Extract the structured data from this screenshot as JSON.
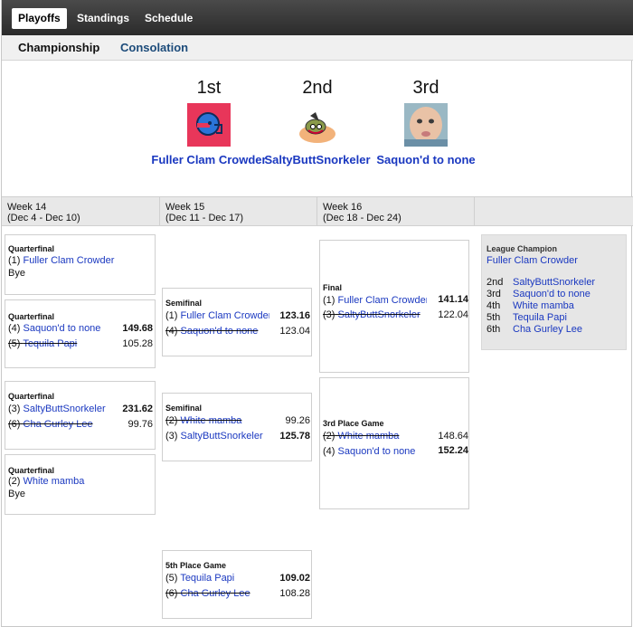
{
  "nav": {
    "tabs": [
      {
        "label": "Playoffs"
      },
      {
        "label": "Standings"
      },
      {
        "label": "Schedule"
      }
    ]
  },
  "subnav": {
    "tabs": [
      {
        "label": "Championship"
      },
      {
        "label": "Consolation"
      }
    ]
  },
  "podium": [
    {
      "place": "1st",
      "name": "Fuller Clam Crowder",
      "icon": "football-helmet-icon"
    },
    {
      "place": "2nd",
      "name": "SaltyButtSnorkeler",
      "icon": "bird-mascot-icon"
    },
    {
      "place": "3rd",
      "name": "Saquon'd to none",
      "icon": "baby-photo-icon"
    }
  ],
  "weeks": [
    {
      "title": "Week 14",
      "range": "(Dec 4 - Dec 10)"
    },
    {
      "title": "Week 15",
      "range": "(Dec 11 - Dec 17)"
    },
    {
      "title": "Week 16",
      "range": "(Dec 18 - Dec 24)"
    }
  ],
  "matches": {
    "qf1": {
      "title": "Quarterfinal",
      "a_seed": "(1)",
      "a_team": "Fuller Clam Crowder",
      "bye": "Bye"
    },
    "qf2": {
      "title": "Quarterfinal",
      "a_seed": "(4)",
      "a_team": "Saquon'd to none",
      "a_score": "149.68",
      "b_seed": "(5)",
      "b_team": "Tequila Papi",
      "b_score": "105.28"
    },
    "qf3": {
      "title": "Quarterfinal",
      "a_seed": "(3)",
      "a_team": "SaltyButtSnorkeler",
      "a_score": "231.62",
      "b_seed": "(6)",
      "b_team": "Cha Gurley Lee",
      "b_score": "99.76"
    },
    "qf4": {
      "title": "Quarterfinal",
      "a_seed": "(2)",
      "a_team": "White mamba",
      "bye": "Bye"
    },
    "sf1": {
      "title": "Semifinal",
      "a_seed": "(1)",
      "a_team": "Fuller Clam Crowder",
      "a_score": "123.16",
      "b_seed": "(4)",
      "b_team": "Saquon'd to none",
      "b_score": "123.04"
    },
    "sf2": {
      "title": "Semifinal",
      "a_seed": "(2)",
      "a_team": "White mamba",
      "a_score": "99.26",
      "b_seed": "(3)",
      "b_team": "SaltyButtSnorkeler",
      "b_score": "125.78"
    },
    "fifth": {
      "title": "5th Place Game",
      "a_seed": "(5)",
      "a_team": "Tequila Papi",
      "a_score": "109.02",
      "b_seed": "(6)",
      "b_team": "Cha Gurley Lee",
      "b_score": "108.28"
    },
    "final": {
      "title": "Final",
      "a_seed": "(1)",
      "a_team": "Fuller Clam Crowder",
      "a_score": "141.14",
      "b_seed": "(3)",
      "b_team": "SaltyButtSnorkeler",
      "b_score": "122.04"
    },
    "third": {
      "title": "3rd Place Game",
      "a_seed": "(2)",
      "a_team": "White mamba",
      "a_score": "148.64",
      "b_seed": "(4)",
      "b_team": "Saquon'd to none",
      "b_score": "152.24"
    }
  },
  "standings": {
    "title": "League Champion",
    "champion": "Fuller Clam Crowder",
    "rows": [
      {
        "place": "2nd",
        "team": "SaltyButtSnorkeler"
      },
      {
        "place": "3rd",
        "team": "Saquon'd to none"
      },
      {
        "place": "4th",
        "team": "White mamba"
      },
      {
        "place": "5th",
        "team": "Tequila Papi"
      },
      {
        "place": "6th",
        "team": "Cha Gurley Lee"
      }
    ]
  },
  "colors": {
    "link": "#1a38c0",
    "nav_bg": "#333333",
    "week_bg": "#e8e8e8"
  }
}
